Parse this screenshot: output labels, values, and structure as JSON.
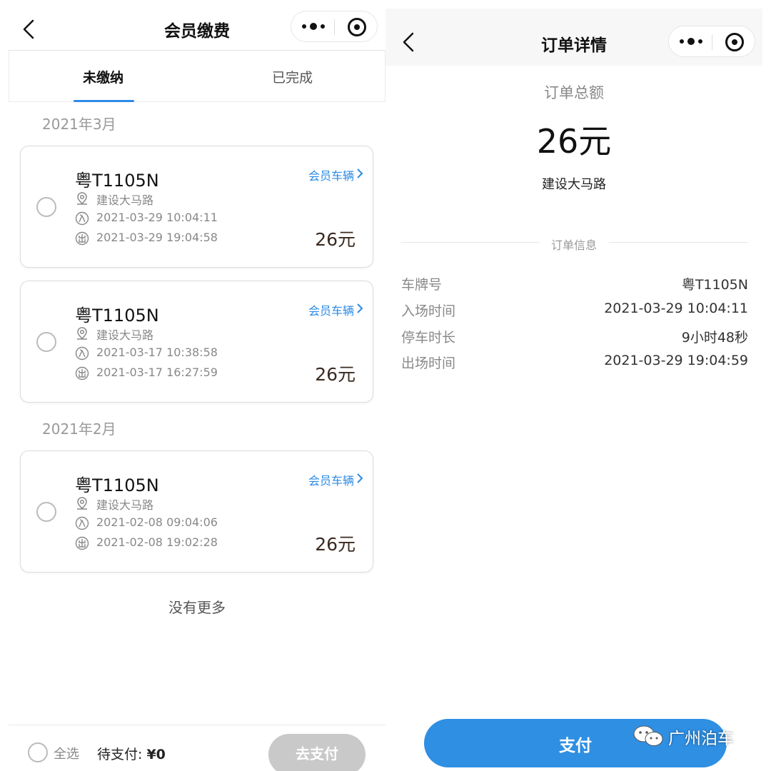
{
  "left_panel": {
    "nav": {
      "title": "会员缴费"
    },
    "tabs": [
      {
        "label": "未缴纳",
        "active": true
      },
      {
        "label": "已完成",
        "active": false
      }
    ],
    "sections": [
      {
        "month": "2021年3月",
        "orders": [
          {
            "plate": "粤T1105N",
            "tag": "会员车辆",
            "location": "建设大马路",
            "entry": "2021-03-29 10:04:11",
            "exit": "2021-03-29 19:04:58",
            "amount": "26元"
          },
          {
            "plate": "粤T1105N",
            "tag": "会员车辆",
            "location": "建设大马路",
            "entry": "2021-03-17 10:38:58",
            "exit": "2021-03-17 16:27:59",
            "amount": "26元"
          }
        ]
      },
      {
        "month": "2021年2月",
        "orders": [
          {
            "plate": "粤T1105N",
            "tag": "会员车辆",
            "location": "建设大马路",
            "entry": "2021-02-08 09:04:06",
            "exit": "2021-02-08 19:02:28",
            "amount": "26元"
          }
        ]
      }
    ],
    "no_more": "没有更多",
    "bottom": {
      "select_all": "全选",
      "pending_label": "待支付:",
      "pending_amount": "¥0",
      "pay_button": "去支付"
    }
  },
  "right_panel": {
    "nav": {
      "title": "订单详情"
    },
    "total_label": "订单总额",
    "total_amount": "26元",
    "location": "建设大马路",
    "info_header": "订单信息",
    "info_rows": [
      {
        "key": "车牌号",
        "value": "粤T1105N"
      },
      {
        "key": "入场时间",
        "value": "2021-03-29 10:04:11"
      },
      {
        "key": "停车时长",
        "value": "9小时48秒"
      },
      {
        "key": "出场时间",
        "value": "2021-03-29 19:04:59"
      }
    ],
    "pay_button": "支付"
  },
  "watermark": {
    "text": "广州泊车"
  },
  "colors": {
    "accent_blue": "#2b8be6",
    "pay_button_blue": "#2f8fe3",
    "disabled_gray": "#c9c9c9",
    "amount_brown": "#3a2a1f"
  }
}
